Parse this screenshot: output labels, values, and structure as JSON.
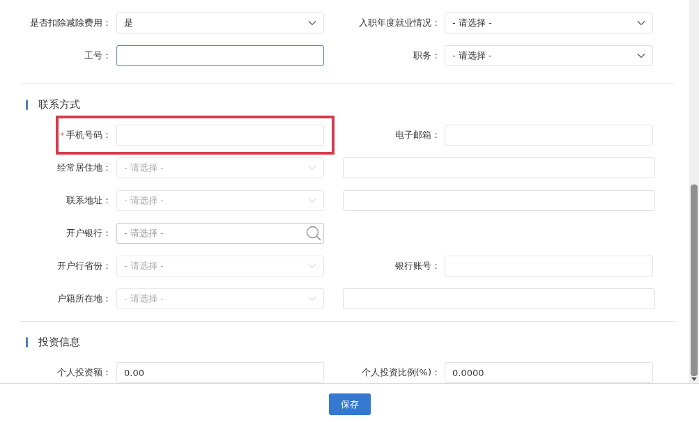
{
  "sections": [
    {
      "rows": [
        {
          "fields": [
            {
              "kind": "select",
              "label": "是否扣除减除费用：",
              "value": "是",
              "disabled": false
            },
            {
              "kind": "select",
              "label": "入职年度就业情况：",
              "value": "- 请选择 -",
              "disabled": false
            }
          ]
        },
        {
          "fields": [
            {
              "kind": "input",
              "label": "工号：",
              "focused": true,
              "disabled": false
            },
            {
              "kind": "select",
              "label": "职务：",
              "value": "- 请选择 -",
              "disabled": false
            }
          ]
        }
      ]
    },
    {
      "title": "联系方式",
      "rows": [
        {
          "fields": [
            {
              "kind": "input",
              "label": "手机号码：",
              "required_mark": "*",
              "highlighted": true,
              "disabled": false
            },
            {
              "kind": "input",
              "label": "电子邮箱：",
              "disabled": false
            }
          ]
        },
        {
          "fields": [
            {
              "kind": "select",
              "label": "经常居住地：",
              "placeholder": "- 请选择 -",
              "disabled": true
            },
            {
              "kind": "input",
              "disabled": false
            }
          ]
        },
        {
          "fields": [
            {
              "kind": "select",
              "label": "联系地址：",
              "placeholder": "- 请选择 -",
              "disabled": true
            },
            {
              "kind": "input",
              "disabled": false
            }
          ]
        },
        {
          "fields": [
            {
              "kind": "search",
              "label": "开户银行：",
              "placeholder": "- 请选择 -",
              "disabled": false
            }
          ]
        },
        {
          "fields": [
            {
              "kind": "select",
              "label": "开户行省份：",
              "placeholder": "- 请选择 -",
              "disabled": true
            },
            {
              "kind": "input",
              "label": "银行账号：",
              "disabled": false
            }
          ]
        },
        {
          "fields": [
            {
              "kind": "select",
              "label": "户籍所在地：",
              "placeholder": "- 请选择 -",
              "disabled": true
            },
            {
              "kind": "input",
              "disabled": false
            }
          ]
        }
      ]
    },
    {
      "title": "投资信息",
      "rows": [
        {
          "fields": [
            {
              "kind": "input",
              "label": "个人投资额：",
              "value": "0.00",
              "disabled": false
            },
            {
              "kind": "input",
              "label": "个人投资比例(%)：",
              "value": "0.0000",
              "disabled": false
            }
          ]
        }
      ]
    }
  ],
  "save_button": "保存"
}
